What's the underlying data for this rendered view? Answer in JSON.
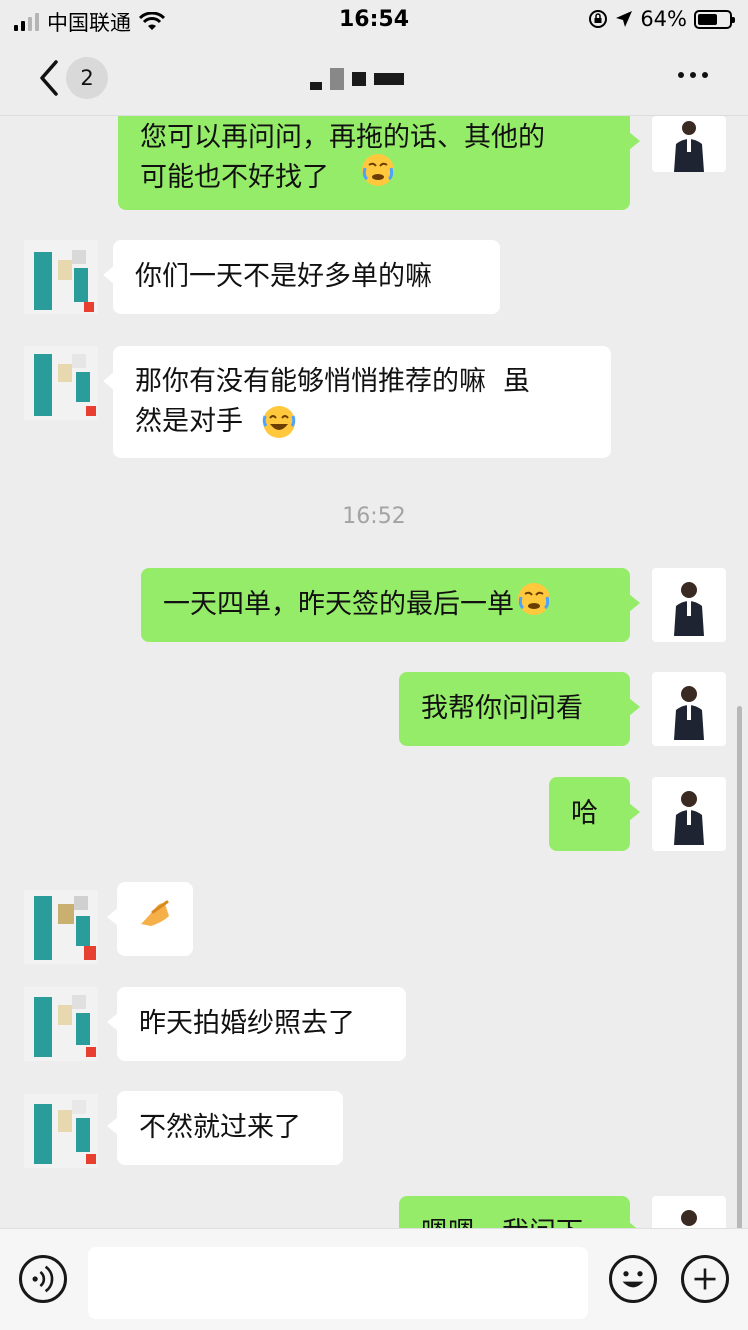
{
  "status_bar": {
    "carrier": "中国联通",
    "time": "16:54",
    "battery_percent": "64%",
    "battery_level": 0.64,
    "icons": [
      "signal-icon",
      "wifi-icon",
      "orientation-lock-icon",
      "location-arrow-icon",
      "battery-icon"
    ]
  },
  "nav": {
    "unread_count": "2",
    "icons": [
      "back-chevron-icon",
      "more-dots-icon"
    ]
  },
  "messages": [
    {
      "side": "self",
      "text": "您可以再问问，再拖的话、其他的\n可能也不好找了",
      "emoji": "face-with-tears-icon"
    },
    {
      "side": "other",
      "text": "你们一天不是好多单的嘛"
    },
    {
      "side": "other",
      "text": "那你有没有能够悄悄推荐的嘛  虽\n然是对手",
      "emoji": "laughing-tears-icon"
    },
    {
      "type": "time",
      "text": "16:52"
    },
    {
      "side": "self",
      "text": "一天四单，昨天签的最后一单",
      "emoji": "face-with-tears-icon"
    },
    {
      "side": "self",
      "text": "我帮你问问看"
    },
    {
      "side": "self",
      "text": "哈"
    },
    {
      "side": "other",
      "text": "",
      "emoji": "pinched-fingers-icon"
    },
    {
      "side": "other",
      "text": "昨天拍婚纱照去了"
    },
    {
      "side": "other",
      "text": "不然就过来了"
    },
    {
      "side": "self",
      "text": "嗯嗯，我问下"
    }
  ],
  "input_bar": {
    "placeholder": "",
    "icons": [
      "voice-icon",
      "emoji-icon",
      "plus-icon"
    ]
  },
  "colors": {
    "background": "#ededed",
    "outgoing_bubble": "#95ec69",
    "incoming_bubble": "#ffffff",
    "timestamp_text": "#a3a3a3"
  }
}
